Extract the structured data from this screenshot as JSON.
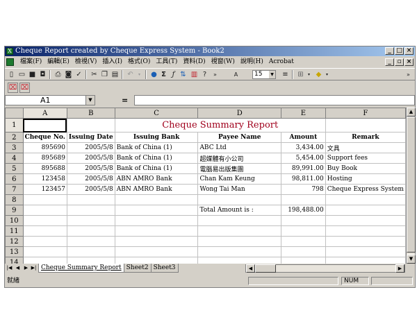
{
  "window": {
    "title": "Cheque Report created by Cheque Express System - Book2",
    "app_icon": "excel-icon"
  },
  "menu": {
    "items": [
      "檔案(F)",
      "編輯(E)",
      "檢視(V)",
      "插入(I)",
      "格式(O)",
      "工具(T)",
      "資料(D)",
      "視窗(W)",
      "說明(H)",
      "Acrobat"
    ]
  },
  "toolbar": {
    "font_size": "15"
  },
  "formula_bar": {
    "name_box": "A1",
    "equals": "=",
    "formula": ""
  },
  "sheet": {
    "columns": [
      "A",
      "B",
      "C",
      "D",
      "E",
      "F"
    ],
    "row_numbers": [
      "1",
      "2",
      "3",
      "4",
      "5",
      "6",
      "7",
      "8",
      "9",
      "10",
      "11",
      "12",
      "13",
      "14"
    ],
    "report_title": "Cheque Summary Report",
    "headers": [
      "Cheque No.",
      "Issuing Date",
      "Issuing Bank",
      "Payee Name",
      "Amount",
      "Remark"
    ],
    "rows": [
      [
        "895690",
        "2005/5/8",
        "Bank of China (1)",
        "ABC Ltd",
        "3,434.00",
        "文具"
      ],
      [
        "895689",
        "2005/5/8",
        "Bank of China (1)",
        "超媒體有小公司",
        "5,454.00",
        "Support fees"
      ],
      [
        "895688",
        "2005/5/8",
        "Bank of China (1)",
        "電腦易出版集團",
        "89,991.00",
        "Buy Book"
      ],
      [
        "123458",
        "2005/5/8",
        "ABN AMRO Bank",
        "Chan Kam Keung",
        "98,811.00",
        "Hosting"
      ],
      [
        "123457",
        "2005/5/8",
        "ABN AMRO Bank",
        "Wong Tai Man",
        "798",
        "Cheque Express System"
      ]
    ],
    "total_label": "Total Amount is :",
    "total_value": "198,488.00"
  },
  "tabs": [
    "Cheque Summary Report",
    "Sheet2",
    "Sheet3"
  ],
  "status": {
    "ready": "就緒",
    "num": "NUM"
  }
}
